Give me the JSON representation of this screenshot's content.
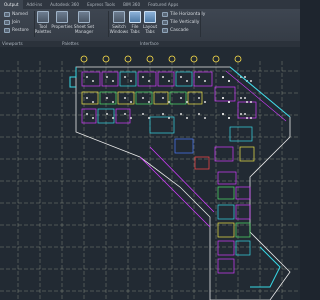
{
  "ribbon_tabs": [
    "Output",
    "Add-ins",
    "Autodesk 360",
    "Express Tools",
    "BIM 360",
    "Featured Apps"
  ],
  "active_tab_index": 0,
  "windows_panel": {
    "named_label": "Named",
    "join_label": "Join",
    "restore_label": "Restore",
    "tool_palettes_label": "Tool Palettes",
    "properties_label": "Properties",
    "sheet_set_label": "Sheet Set Manager",
    "switch_windows_label": "Switch Windows",
    "file_tabs_label": "File Tabs",
    "layout_tabs_label": "Layout Tabs",
    "tile_horizontally_label": "Tile Horizontally",
    "tile_vertically_label": "Tile Vertically",
    "cascade_label": "Cascade"
  },
  "panel_labels": {
    "viewports": "Viewports",
    "palettes": "Palettes",
    "interface": "Interface"
  },
  "colors": {
    "grid": "#c9cdb0",
    "grid_bubble": "#ffe24a",
    "walls_magenta": "#d23cff",
    "walls_cyan": "#37d9e6",
    "walls_white": "#e8e8e8",
    "walls_yellow": "#f0e548",
    "walls_green": "#4fe36a",
    "walls_blue": "#4a7bff",
    "walls_red": "#ff4848"
  }
}
